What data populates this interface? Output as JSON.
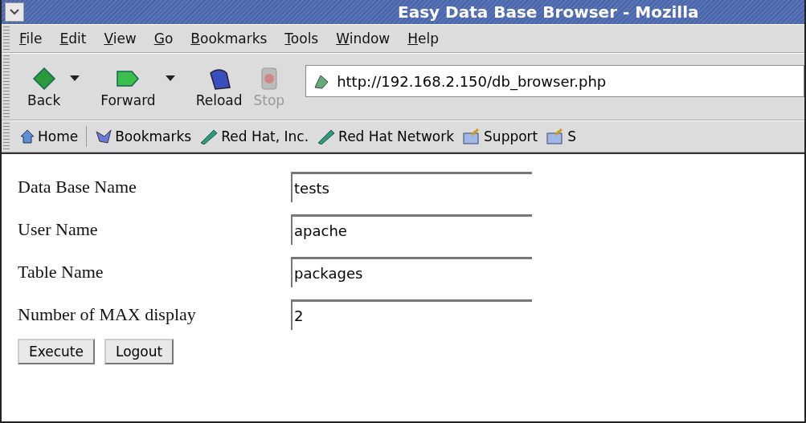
{
  "window": {
    "title": "Easy Data Base Browser - Mozilla"
  },
  "menu": [
    "File",
    "Edit",
    "View",
    "Go",
    "Bookmarks",
    "Tools",
    "Window",
    "Help"
  ],
  "nav_buttons": [
    {
      "label": "Back",
      "kind": "back",
      "disabled": false,
      "dropdown": true
    },
    {
      "label": "Forward",
      "kind": "forward",
      "disabled": false,
      "dropdown": true
    },
    {
      "label": "Reload",
      "kind": "reload",
      "disabled": false,
      "dropdown": false
    },
    {
      "label": "Stop",
      "kind": "stop",
      "disabled": true,
      "dropdown": false
    }
  ],
  "address": {
    "value": "http://192.168.2.150/db_browser.php"
  },
  "bookmarks": [
    {
      "label": "Home",
      "kind": "home"
    },
    {
      "label": "Bookmarks",
      "kind": "bookmarks"
    },
    {
      "label": "Red Hat, Inc.",
      "kind": "link"
    },
    {
      "label": "Red Hat Network",
      "kind": "link"
    },
    {
      "label": "Support",
      "kind": "folder"
    },
    {
      "label": "S",
      "kind": "folder"
    }
  ],
  "form": {
    "fields": [
      {
        "label": "Data Base Name",
        "value": "tests"
      },
      {
        "label": "User Name",
        "value": "apache"
      },
      {
        "label": "Table Name",
        "value": "packages"
      },
      {
        "label": "Number of MAX display",
        "value": "2"
      }
    ],
    "buttons": [
      "Execute",
      "Logout"
    ]
  }
}
